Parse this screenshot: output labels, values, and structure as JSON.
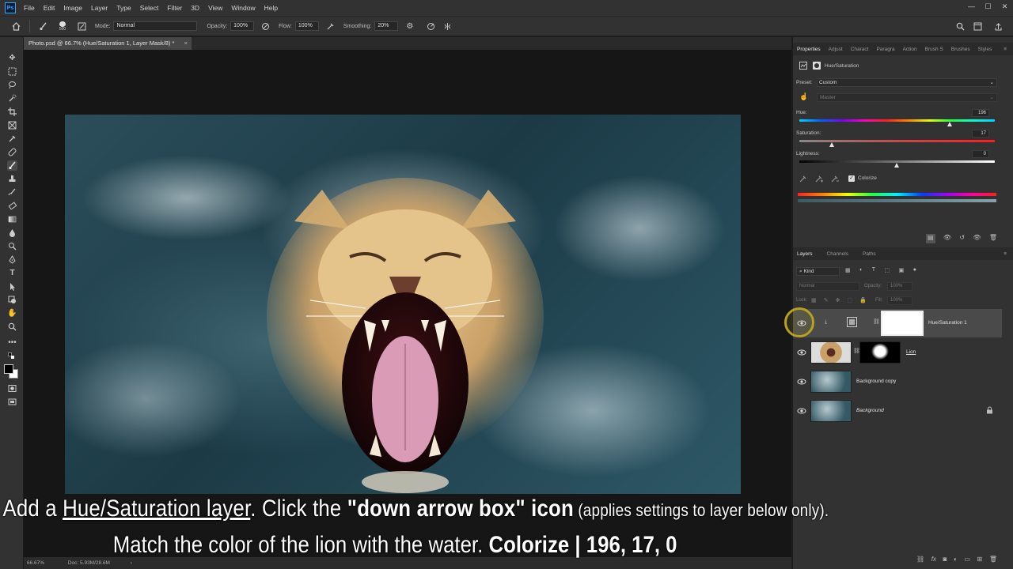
{
  "app": {
    "menu": [
      "File",
      "Edit",
      "Image",
      "Layer",
      "Type",
      "Select",
      "Filter",
      "3D",
      "View",
      "Window",
      "Help"
    ],
    "logo_text": "Ps",
    "window_controls": [
      "—",
      "☐",
      "✕"
    ]
  },
  "options_bar": {
    "brush_size": "500",
    "mode_label": "Mode:",
    "mode_value": "Normal",
    "opacity_label": "Opacity:",
    "opacity_value": "100%",
    "flow_label": "Flow:",
    "flow_value": "100%",
    "smoothing_label": "Smoothing:",
    "smoothing_value": "20%"
  },
  "document": {
    "tab_title": "Photo.psd @ 66.7% (Hue/Saturation 1, Layer Mask/8) *",
    "zoom": "66.67%",
    "doc_info": "Doc: 5.93M/28.6M"
  },
  "properties": {
    "tabs": [
      "Properties",
      "Adjust",
      "Charact",
      "Paragra",
      "Action",
      "Brush S",
      "Brushes",
      "Styles"
    ],
    "title": "Hue/Saturation",
    "preset_label": "Preset:",
    "preset_value": "Custom",
    "channel_value": "Master",
    "hue_label": "Hue:",
    "hue_value": "196",
    "hue_fraction": 0.772,
    "saturation_label": "Saturation:",
    "saturation_value": "17",
    "saturation_fraction": 0.168,
    "lightness_label": "Lightness:",
    "lightness_value": "0",
    "lightness_fraction": 0.5,
    "colorize_label": "Colorize",
    "colorize_checked": true
  },
  "layers": {
    "tabs": [
      "Layers",
      "Channels",
      "Paths"
    ],
    "filter_kind": "Kind",
    "blend_mode": "Normal",
    "opacity_label": "Opacity:",
    "opacity_value": "100%",
    "lock_label": "Lock:",
    "fill_label": "Fill:",
    "fill_value": "100%",
    "items": [
      {
        "name": "Hue/Saturation 1",
        "selected": true
      },
      {
        "name": "Lion",
        "selected": false
      },
      {
        "name": "Background copy",
        "selected": false
      },
      {
        "name": "Background",
        "selected": false,
        "locked": true
      }
    ]
  },
  "caption": {
    "line1_a": "Add a ",
    "line1_b": "Hue/Saturation layer",
    "line1_c": ". Click the ",
    "line1_d": "\"down arrow box\" icon",
    "line1_e": " (applies settings to layer below only).",
    "line2_a": "Match the color of the lion with the water. ",
    "line2_b": "Colorize  |  196, 17, 0"
  }
}
